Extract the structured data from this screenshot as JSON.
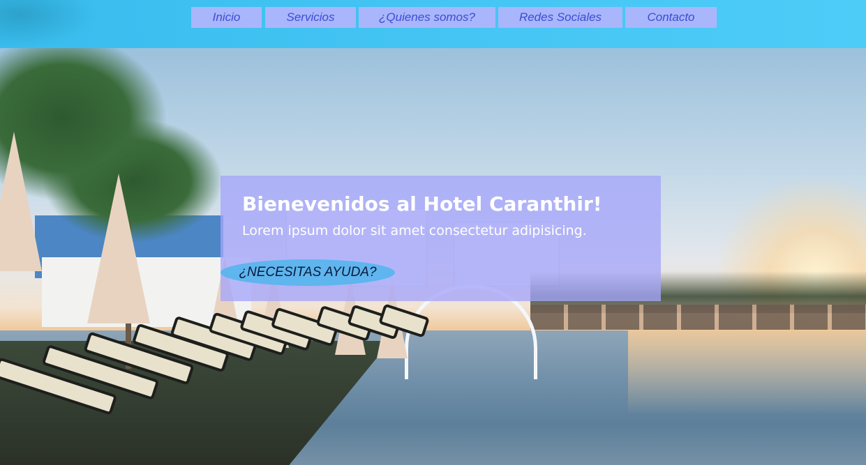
{
  "nav": {
    "items": [
      {
        "label": "Inicio"
      },
      {
        "label": "Servicios"
      },
      {
        "label": "¿Quienes somos?"
      },
      {
        "label": "Redes Sociales"
      },
      {
        "label": "Contacto"
      }
    ]
  },
  "hero": {
    "title": "Bienevenidos al Hotel Caranthir!",
    "subtitle": "Lorem ipsum dolor sit amet consectetur adipisicing.",
    "help_button_label": "¿NECESITAS AYUDA?"
  },
  "colors": {
    "topbar": "#46c6f4",
    "nav_item_bg": "#a9b6fb",
    "nav_item_text": "#3c4cd6",
    "overlay_bg": "#a5a5fa",
    "help_button_bg": "#5fb5ee"
  }
}
